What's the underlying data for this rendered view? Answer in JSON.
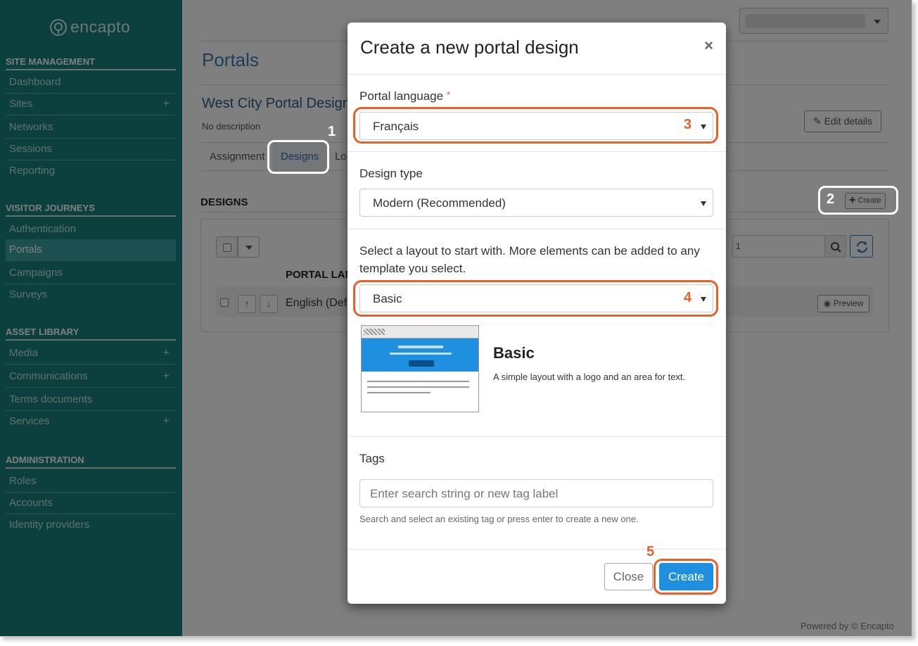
{
  "app": {
    "logo_text": "encapto",
    "footer": "Powered by © Encapto"
  },
  "sidebar": {
    "sections": [
      {
        "title": "SITE MANAGEMENT",
        "items": [
          "Dashboard",
          "Sites",
          "Networks",
          "Sessions",
          "Reporting"
        ]
      },
      {
        "title": "VISITOR JOURNEYS",
        "items": [
          "Authentication",
          "Portals",
          "Campaigns",
          "Surveys"
        ]
      },
      {
        "title": "ASSET LIBRARY",
        "items": [
          "Media",
          "Communications",
          "Terms documents",
          "Services"
        ]
      },
      {
        "title": "ADMINISTRATION",
        "items": [
          "Roles",
          "Accounts",
          "Identity providers"
        ]
      }
    ],
    "active_item": "Portals",
    "plus_icon": "+"
  },
  "main": {
    "page_title": "Portals",
    "portal_name": "West City Portal Design",
    "description": "No description",
    "edit_details_label": "Edit details",
    "tabs": [
      "Assignment",
      "Designs",
      "Lo"
    ],
    "active_tab": "Designs",
    "designs_heading": "DESIGNS",
    "create_small_label": "Create",
    "search_value": "1",
    "table_header": "PORTAL LANGUAGE",
    "row_language": "English (Default)",
    "preview_label": "Preview"
  },
  "callouts": {
    "n1": "1",
    "n2": "2",
    "n3": "3",
    "n4": "4",
    "n5": "5"
  },
  "modal": {
    "title": "Create a new portal design",
    "close_symbol": "×",
    "language_label": "Portal language",
    "required_mark": "*",
    "language_value": "Français",
    "design_type_label": "Design type",
    "design_type_value": "Modern (Recommended)",
    "layout_prompt": "Select a layout to start with. More elements can be added to any template you select.",
    "layout_value": "Basic",
    "layout_name": "Basic",
    "layout_description": "A simple layout with a logo and an area for text.",
    "tags_label": "Tags",
    "tags_placeholder": "Enter search string or new tag label",
    "tags_help": "Search and select an existing tag or press enter to create a new one.",
    "close_button": "Close",
    "create_button": "Create"
  },
  "colors": {
    "sidebar": "#16807f",
    "accent_blue": "#1f8fe0",
    "callout_orange": "#e8612c"
  }
}
